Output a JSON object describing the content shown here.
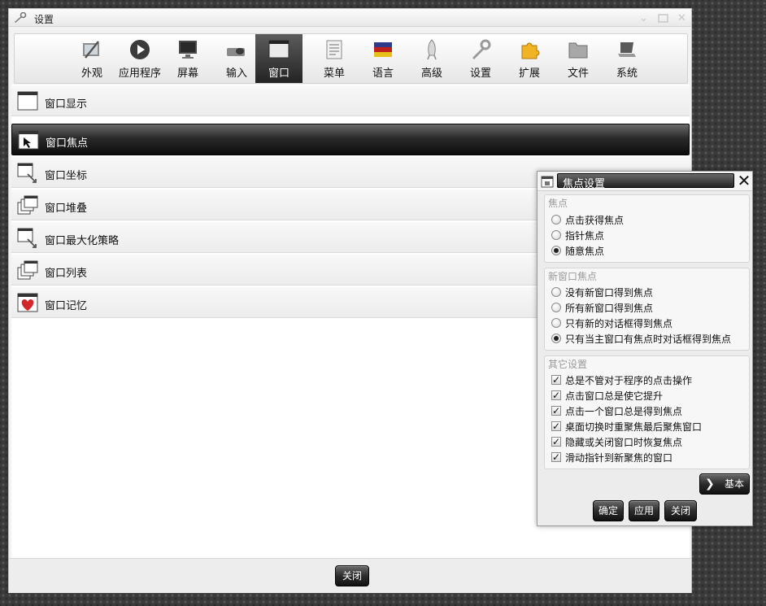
{
  "window": {
    "title": "设置",
    "controls": [
      "chevron-down",
      "restore",
      "close"
    ]
  },
  "toolbar": {
    "items": [
      {
        "label": "外观",
        "icon": "appearance-icon"
      },
      {
        "label": "应用程序",
        "icon": "applications-icon"
      },
      {
        "label": "屏幕",
        "icon": "monitor-icon"
      },
      {
        "label": "输入",
        "icon": "keyboard-mouse-icon"
      },
      {
        "label": "窗口",
        "icon": "window-icon",
        "active": true
      },
      {
        "label": "菜单",
        "icon": "menu-icon"
      },
      {
        "label": "语言",
        "icon": "flag-icon"
      },
      {
        "label": "高级",
        "icon": "rocket-icon"
      },
      {
        "label": "设置",
        "icon": "wrench-icon"
      },
      {
        "label": "扩展",
        "icon": "puzzle-icon"
      },
      {
        "label": "文件",
        "icon": "folder-icon"
      },
      {
        "label": "系统",
        "icon": "laptop-icon"
      }
    ]
  },
  "list": {
    "items": [
      {
        "label": "窗口显示",
        "icon": "window-icon"
      },
      {
        "label": "窗口焦点",
        "icon": "window-pointer-icon",
        "selected": true
      },
      {
        "label": "窗口坐标",
        "icon": "window-move-icon"
      },
      {
        "label": "窗口堆叠",
        "icon": "window-stack-icon"
      },
      {
        "label": "窗口最大化策略",
        "icon": "window-move-icon"
      },
      {
        "label": "窗口列表",
        "icon": "window-stack-icon"
      },
      {
        "label": "窗口记忆",
        "icon": "window-heart-icon"
      }
    ]
  },
  "footer": {
    "close_label": "关闭"
  },
  "dialog": {
    "title": "焦点设置",
    "focus": {
      "title": "焦点",
      "options": [
        {
          "label": "点击获得焦点",
          "checked": false
        },
        {
          "label": "指针焦点",
          "checked": false
        },
        {
          "label": "随意焦点",
          "checked": true
        }
      ]
    },
    "new_window_focus": {
      "title": "新窗口焦点",
      "options": [
        {
          "label": "没有新窗口得到焦点",
          "checked": false
        },
        {
          "label": "所有新窗口得到焦点",
          "checked": false
        },
        {
          "label": "只有新的对话框得到焦点",
          "checked": false
        },
        {
          "label": "只有当主窗口有焦点时对话框得到焦点",
          "checked": true
        }
      ]
    },
    "other": {
      "title": "其它设置",
      "options": [
        {
          "label": "总是不管对于程序的点击操作",
          "checked": true
        },
        {
          "label": "点击窗口总是使它提升",
          "checked": true
        },
        {
          "label": "点击一个窗口总是得到焦点",
          "checked": true
        },
        {
          "label": "桌面切换时重聚焦最后聚焦窗口",
          "checked": true
        },
        {
          "label": "隐藏或关闭窗口时恢复焦点",
          "checked": true
        },
        {
          "label": "滑动指针到新聚焦的窗口",
          "checked": true
        }
      ]
    },
    "basic_label": "基本",
    "buttons": {
      "ok": "确定",
      "apply": "应用",
      "close": "关闭"
    }
  }
}
